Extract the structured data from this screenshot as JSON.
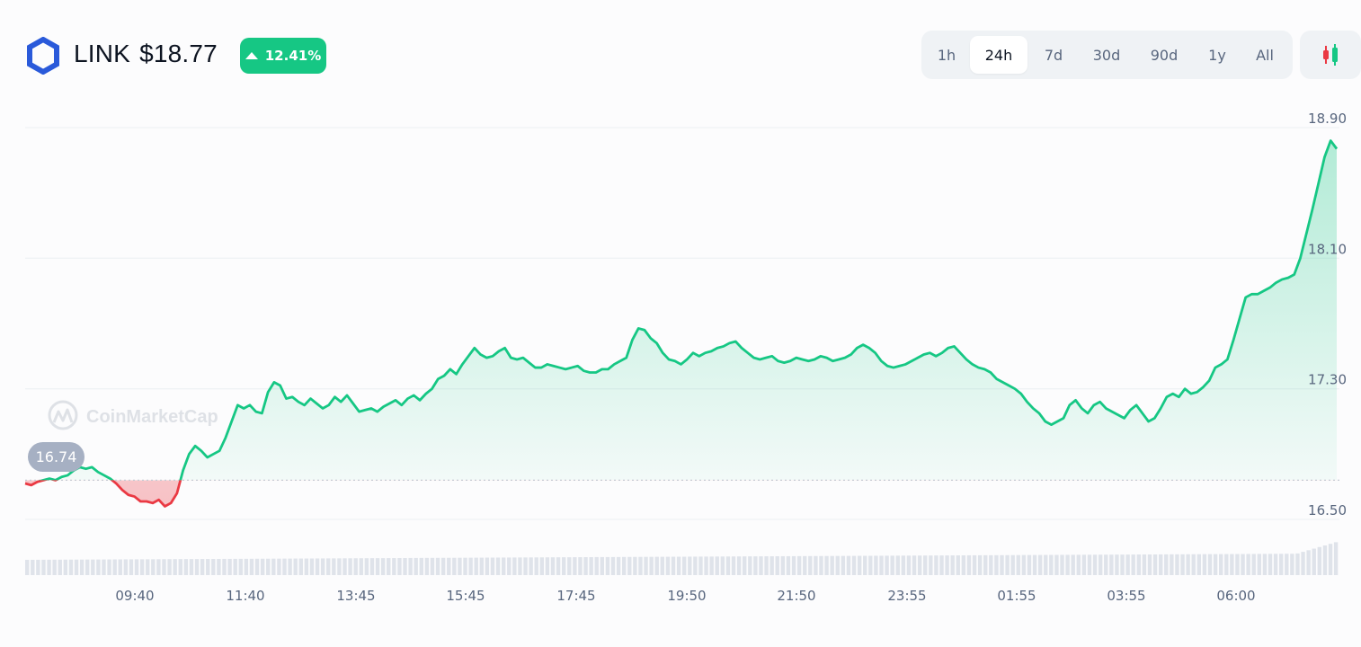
{
  "header": {
    "symbol": "LINK",
    "price": "$18.77",
    "change": "12.41%"
  },
  "tabs": [
    {
      "label": "1h",
      "active": false
    },
    {
      "label": "24h",
      "active": true
    },
    {
      "label": "7d",
      "active": false
    },
    {
      "label": "30d",
      "active": false
    },
    {
      "label": "90d",
      "active": false
    },
    {
      "label": "1y",
      "active": false
    },
    {
      "label": "All",
      "active": false
    }
  ],
  "candle_button": {
    "icon": "candlestick-icon"
  },
  "watermark": "CoinMarketCap",
  "colors": {
    "up": "#16c784",
    "down": "#ea3943",
    "grid": "#eff2f5",
    "axis_text": "#58667e",
    "brand_blue": "#2a5ada"
  },
  "chart_data": {
    "type": "area",
    "baseline": 16.74,
    "baseline_label": "16.74",
    "ylim": [
      16.5,
      18.9
    ],
    "y_ticks": [
      16.5,
      17.3,
      18.1,
      18.9
    ],
    "y_tick_labels": [
      "16.50",
      "17.30",
      "18.10",
      "18.90"
    ],
    "x_tick_labels": [
      "09:40",
      "11:40",
      "13:45",
      "15:45",
      "17:45",
      "19:50",
      "21:50",
      "23:55",
      "01:55",
      "03:55",
      "06:00"
    ],
    "grid": true,
    "series": [
      {
        "values": [
          16.72,
          16.71,
          16.73,
          16.74,
          16.75,
          16.74,
          16.76,
          16.77,
          16.8,
          16.82,
          16.81,
          16.82,
          16.79,
          16.77,
          16.75,
          16.72,
          16.68,
          16.65,
          16.64,
          16.61,
          16.61,
          16.6,
          16.62,
          16.58,
          16.6,
          16.66,
          16.8,
          16.9,
          16.95,
          16.92,
          16.88,
          16.9,
          16.92,
          17.0,
          17.1,
          17.2,
          17.18,
          17.2,
          17.16,
          17.15,
          17.28,
          17.34,
          17.32,
          17.24,
          17.25,
          17.22,
          17.2,
          17.24,
          17.21,
          17.18,
          17.2,
          17.25,
          17.22,
          17.26,
          17.21,
          17.16,
          17.17,
          17.18,
          17.16,
          17.19,
          17.21,
          17.23,
          17.2,
          17.24,
          17.26,
          17.23,
          17.27,
          17.3,
          17.36,
          17.38,
          17.42,
          17.39,
          17.45,
          17.5,
          17.55,
          17.51,
          17.49,
          17.5,
          17.53,
          17.55,
          17.49,
          17.48,
          17.49,
          17.46,
          17.43,
          17.43,
          17.45,
          17.44,
          17.43,
          17.42,
          17.43,
          17.44,
          17.41,
          17.4,
          17.4,
          17.42,
          17.42,
          17.45,
          17.47,
          17.49,
          17.6,
          17.67,
          17.66,
          17.61,
          17.58,
          17.52,
          17.48,
          17.47,
          17.45,
          17.48,
          17.52,
          17.5,
          17.52,
          17.53,
          17.55,
          17.56,
          17.58,
          17.59,
          17.55,
          17.52,
          17.49,
          17.48,
          17.49,
          17.5,
          17.47,
          17.46,
          17.47,
          17.49,
          17.48,
          17.47,
          17.48,
          17.5,
          17.49,
          17.47,
          17.48,
          17.49,
          17.51,
          17.55,
          17.57,
          17.55,
          17.52,
          17.47,
          17.44,
          17.43,
          17.44,
          17.45,
          17.47,
          17.49,
          17.51,
          17.52,
          17.5,
          17.52,
          17.55,
          17.56,
          17.52,
          17.48,
          17.45,
          17.43,
          17.42,
          17.4,
          17.36,
          17.34,
          17.32,
          17.3,
          17.27,
          17.22,
          17.18,
          17.15,
          17.1,
          17.08,
          17.1,
          17.12,
          17.2,
          17.23,
          17.18,
          17.15,
          17.2,
          17.22,
          17.18,
          17.16,
          17.14,
          17.12,
          17.17,
          17.2,
          17.15,
          17.1,
          17.12,
          17.18,
          17.25,
          17.27,
          17.25,
          17.3,
          17.27,
          17.28,
          17.31,
          17.35,
          17.43,
          17.45,
          17.48,
          17.6,
          17.73,
          17.86,
          17.88,
          17.88,
          17.9,
          17.92,
          17.95,
          17.97,
          17.98,
          18.0,
          18.1,
          18.25,
          18.4,
          18.56,
          18.72,
          18.82,
          18.77
        ]
      }
    ]
  }
}
